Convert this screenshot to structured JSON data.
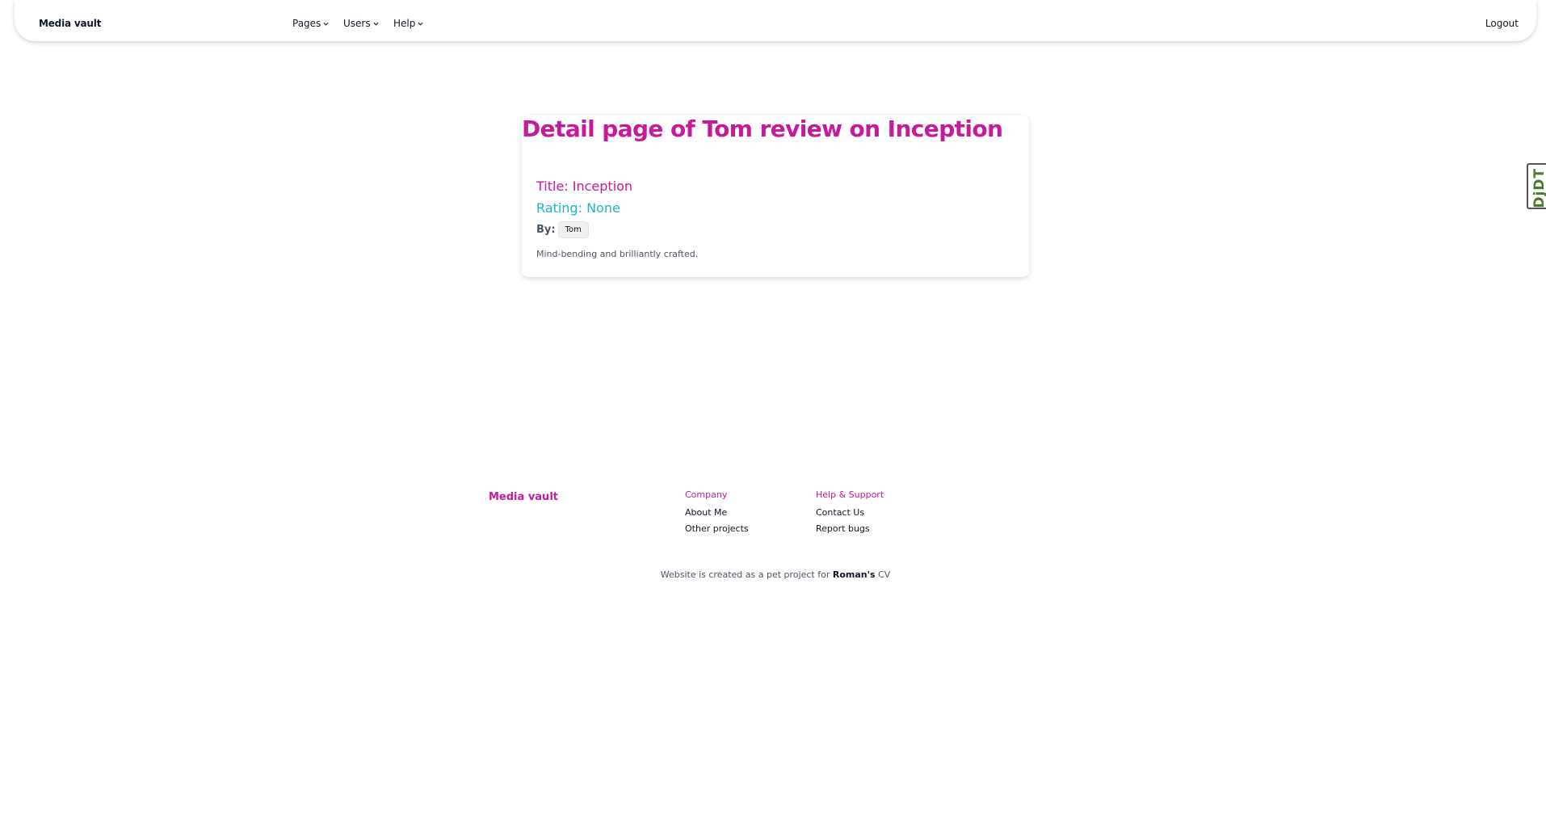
{
  "navbar": {
    "brand": "Media vault",
    "menus": [
      {
        "label": "Pages"
      },
      {
        "label": "Users"
      },
      {
        "label": "Help"
      }
    ],
    "logout_label": "Logout"
  },
  "review": {
    "heading": "Detail page of Tom review on Inception",
    "title_text": "Title: Inception",
    "rating_text": "Rating: None",
    "by_label": "By:",
    "author": "Tom",
    "body": "Mind-bending and brilliantly crafted."
  },
  "side_widget": {
    "label": "DjDT"
  },
  "footer": {
    "brand": "Media vault",
    "company": {
      "heading": "Company",
      "links": [
        "About Me",
        "Other projects"
      ]
    },
    "support": {
      "heading": "Help & Support",
      "links": [
        "Contact Us",
        "Report bugs"
      ]
    },
    "note_prefix": "Website is created as a pet project for ",
    "note_name": "Roman's",
    "note_link": "CV"
  },
  "colors": {
    "accent": "#c51a9b",
    "rating": "#19b5c9"
  },
  "icons": {
    "menu_chevron": "chevron-down-icon"
  }
}
